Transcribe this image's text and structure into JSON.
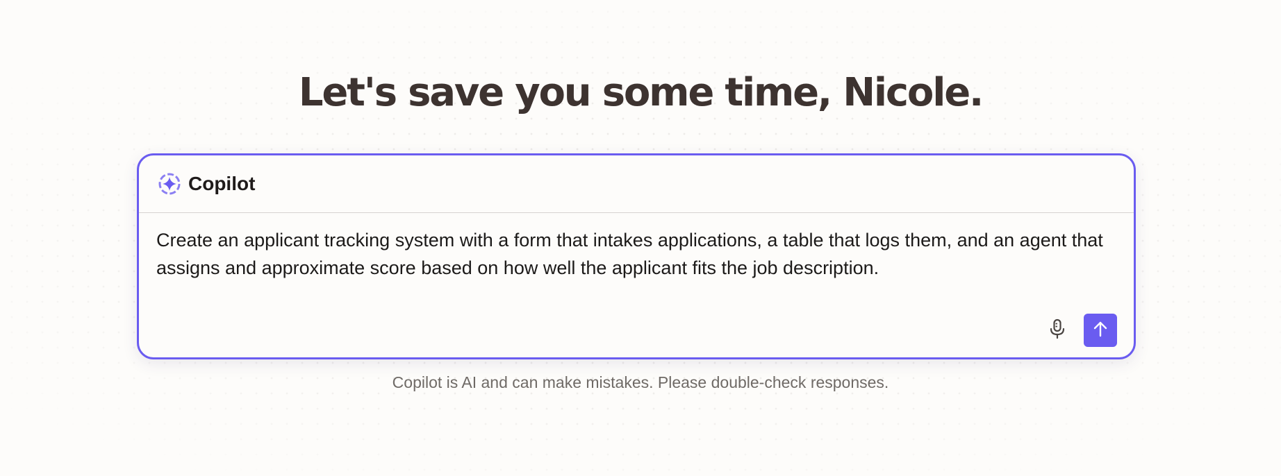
{
  "headline": "Let's save you some time, Nicole.",
  "copilot": {
    "title": "Copilot",
    "icon": "copilot-sparkle-icon",
    "prompt_value": "Create an applicant tracking system with a form that intakes applications, a table that logs them, and an agent that assigns and approximate score based on how well the applicant fits the job description.",
    "mic_icon": "microphone-icon",
    "send_icon": "arrow-up-icon"
  },
  "disclaimer": "Copilot is AI and can make mistakes. Please double-check responses.",
  "colors": {
    "accent": "#6a5cf0",
    "headline": "#3d3330",
    "background": "#fdfcfa"
  }
}
